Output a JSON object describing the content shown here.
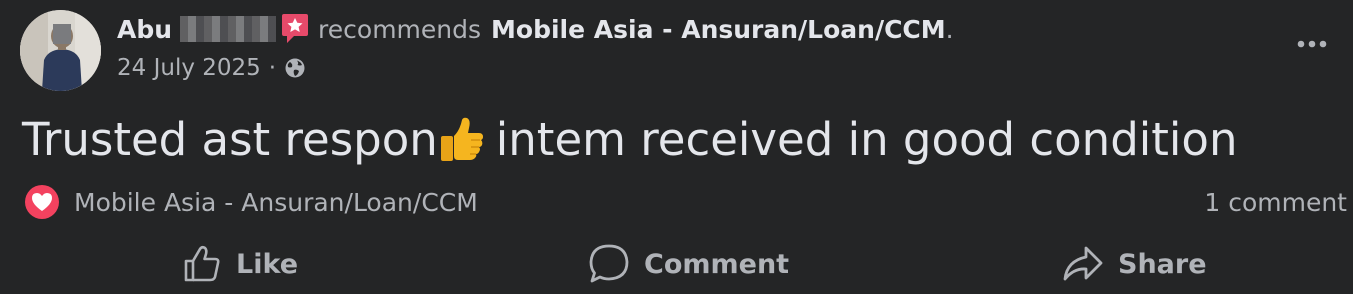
{
  "post": {
    "author": "Abu",
    "verb": "recommends",
    "page_name": "Mobile Asia - Ansuran/Loan/CCM",
    "period": ".",
    "date": "24 July 2025",
    "date_separator": "·",
    "audience_icon": "globe-icon",
    "text_before_emoji": "Trusted ast respon",
    "emoji": "thumbs-up",
    "text_after_emoji": "intem received in good condition"
  },
  "reactions": {
    "icon": "love-reaction",
    "page_label": "Mobile Asia - Ansuran/Loan/CCM",
    "comments": "1 comment"
  },
  "actions": {
    "like": "Like",
    "comment": "Comment",
    "share": "Share"
  },
  "colors": {
    "background": "#242526",
    "primary_text": "#e4e6eb",
    "secondary_text": "#b0b3b8",
    "love_red": "#f3425f",
    "badge_pink": "#e74a6a"
  }
}
